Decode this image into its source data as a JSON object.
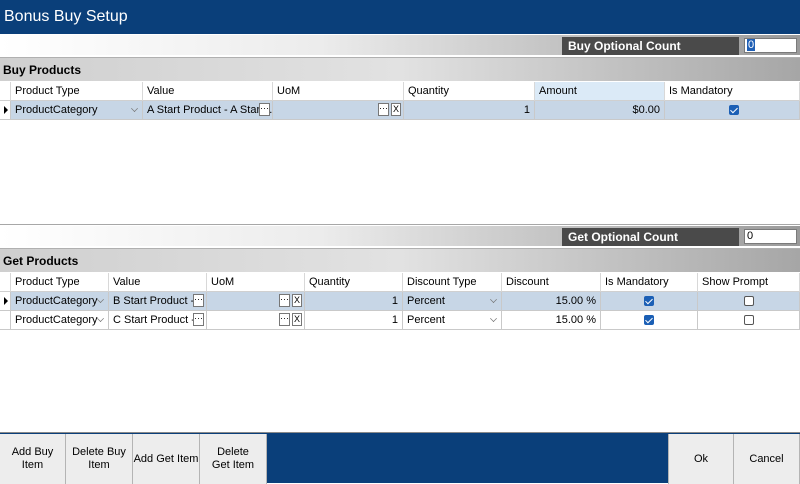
{
  "window": {
    "title": "Bonus Buy Setup"
  },
  "buy_optional": {
    "label": "Buy Optional Count",
    "value": "0"
  },
  "buy_products": {
    "title": "Buy Products",
    "columns": [
      "Product Type",
      "Value",
      "UoM",
      "Quantity",
      "Amount",
      "Is Mandatory"
    ],
    "rows": [
      {
        "product_type": "ProductCategory",
        "value": "A Start Product - A Start...",
        "ellipsis": "···",
        "uom": "",
        "uom_ellipsis": "···",
        "uom_clear": "X",
        "quantity": "1",
        "amount": "$0.00",
        "is_mandatory": true
      }
    ]
  },
  "get_optional": {
    "label": "Get Optional Count",
    "value": "0"
  },
  "get_products": {
    "title": "Get Products",
    "columns": [
      "Product Type",
      "Value",
      "UoM",
      "Quantity",
      "Discount Type",
      "Discount",
      "Is Mandatory",
      "Show Prompt"
    ],
    "rows": [
      {
        "product_type": "ProductCategory",
        "value": "B Start Product -...",
        "ellipsis": "···",
        "uom": "",
        "uom_ellipsis": "···",
        "uom_clear": "X",
        "quantity": "1",
        "discount_type": "Percent",
        "discount": "15.00 %",
        "is_mandatory": true,
        "show_prompt": false
      },
      {
        "product_type": "ProductCategory",
        "value": "C Start Product -...",
        "ellipsis": "···",
        "uom": "",
        "uom_ellipsis": "···",
        "uom_clear": "X",
        "quantity": "1",
        "discount_type": "Percent",
        "discount": "15.00 %",
        "is_mandatory": true,
        "show_prompt": false
      }
    ]
  },
  "footer": {
    "add_buy": "Add Buy Item",
    "delete_buy": "Delete Buy Item",
    "add_get": "Add Get Item",
    "delete_get": "Delete Get Item",
    "ok": "Ok",
    "cancel": "Cancel"
  },
  "colors": {
    "title_bar": "#0a3f7a",
    "selected_row": "#c7d6e6",
    "checkbox": "#1b5fb5"
  }
}
